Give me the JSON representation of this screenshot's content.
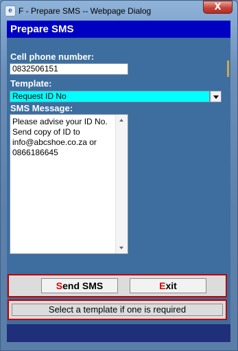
{
  "window": {
    "title": "F - Prepare SMS -- Webpage Dialog",
    "close_glyph": "X",
    "icon": "ie-icon"
  },
  "header": {
    "title": "Prepare SMS"
  },
  "form": {
    "cell_label": "Cell phone number:",
    "cell_value": "0832506151",
    "template_label": "Template:",
    "template_value": "Request ID No",
    "sms_label": "SMS Message:",
    "sms_value": "Please advise your ID No. Send copy of ID to info@abcshoe.co.za or 0866186645"
  },
  "buttons": {
    "send_hot": "S",
    "send_rest": "end SMS",
    "exit_hot": "E",
    "exit_rest": "xit"
  },
  "status": {
    "text": "Select a template if one is required"
  },
  "colors": {
    "header_bg": "#0000c2",
    "template_bg": "#00ffff",
    "accent_red": "#c00000"
  }
}
